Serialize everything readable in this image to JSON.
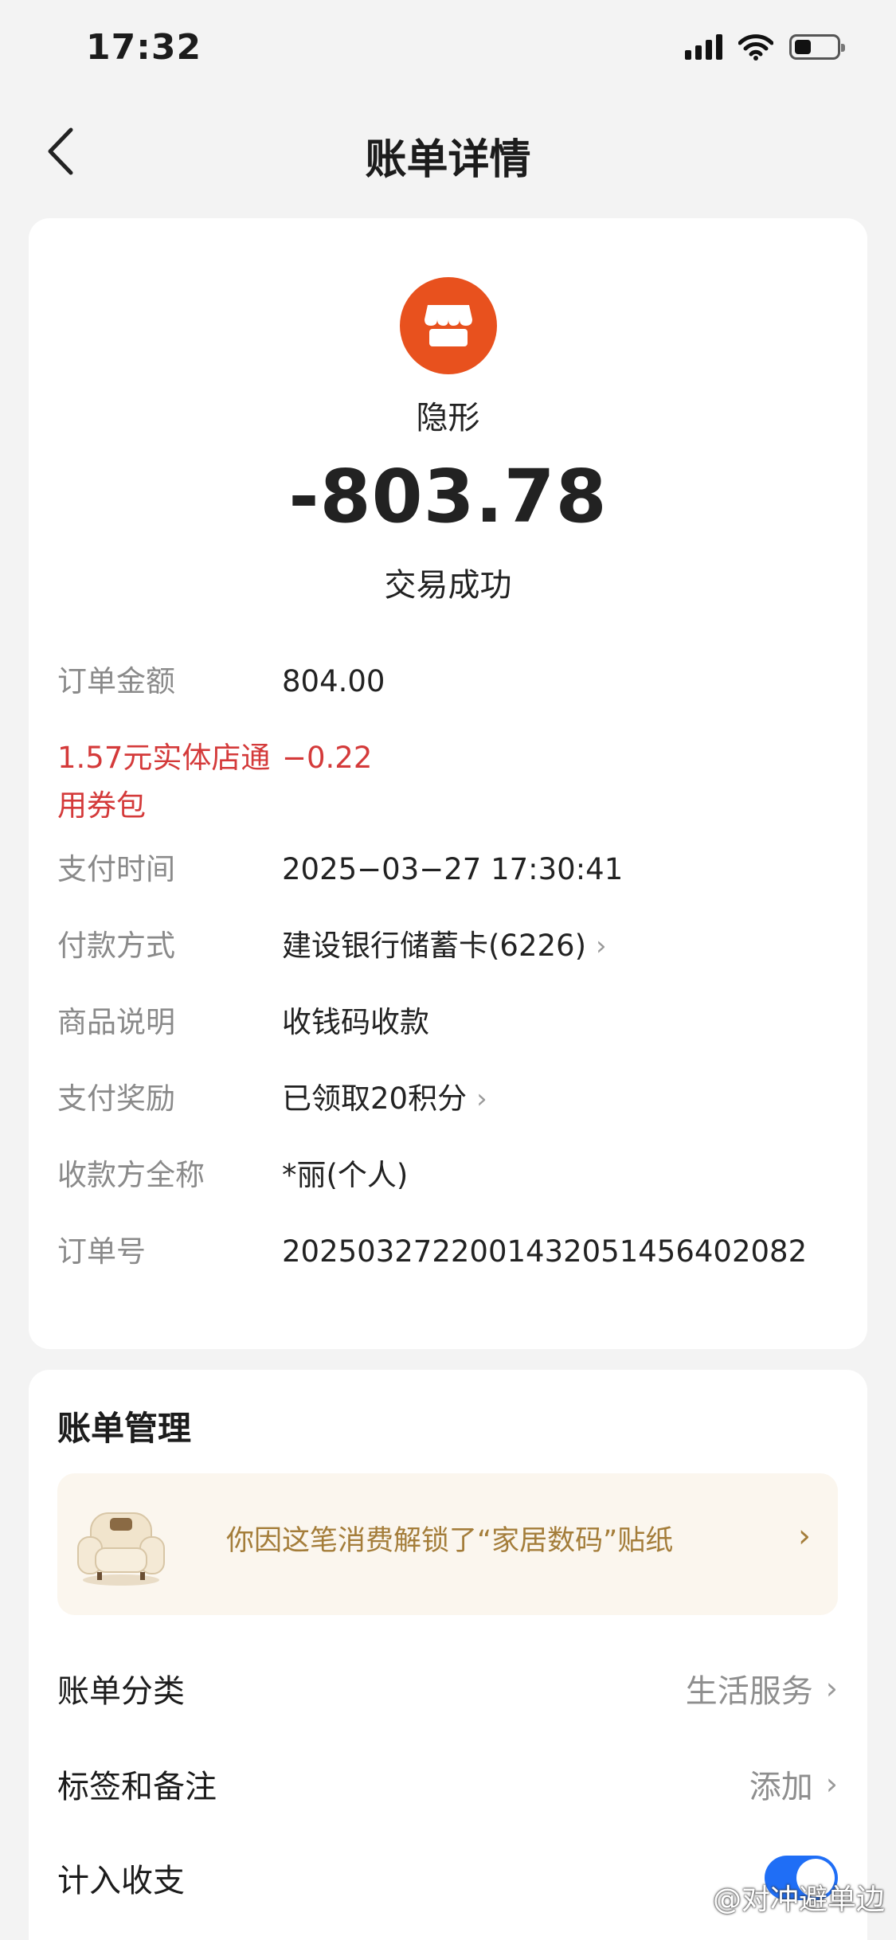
{
  "status_bar": {
    "time": "17:32",
    "icons": [
      "signal-icon",
      "wifi-icon",
      "battery-icon"
    ]
  },
  "nav": {
    "title": "账单详情",
    "back_icon": "chevron-left-icon"
  },
  "merchant": {
    "name": "隐形",
    "icon": "store-icon",
    "icon_color": "#e8511e"
  },
  "transaction": {
    "amount": "-803.78",
    "status": "交易成功"
  },
  "details": {
    "order_amount": {
      "label": "订单金额",
      "value": "804.00"
    },
    "coupon": {
      "label": "1.57元实体店通用券包",
      "value": "−0.22",
      "color": "#d43a3a"
    },
    "pay_time": {
      "label": "支付时间",
      "value": "2025−03−27 17:30:41"
    },
    "pay_method": {
      "label": "付款方式",
      "value": "建设银行储蓄卡(6226)"
    },
    "item_desc": {
      "label": "商品说明",
      "value": "收钱码收款"
    },
    "reward": {
      "label": "支付奖励",
      "value": "已领取20积分"
    },
    "payee": {
      "label": "收款方全称",
      "value": "*丽(个人)"
    },
    "order_no": {
      "label": "订单号",
      "value": "2025032722001432051456402082"
    }
  },
  "manage": {
    "title": "账单管理",
    "banner": {
      "text": "你因这笔消费解锁了“家居数码”贴纸",
      "icon": "armchair-sticker-icon"
    },
    "category": {
      "label": "账单分类",
      "value": "生活服务"
    },
    "tags": {
      "label": "标签和备注",
      "value": "添加"
    },
    "count": {
      "label": "计入收支",
      "enabled": true,
      "toggle_color": "#1f6ef6"
    }
  },
  "watermark": "@对冲避单边"
}
